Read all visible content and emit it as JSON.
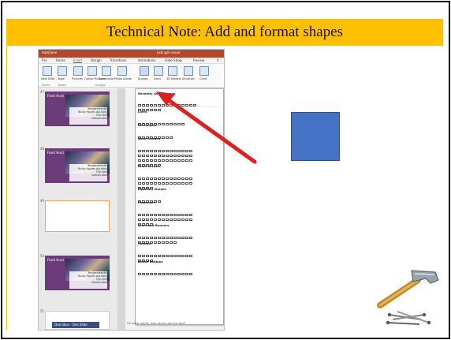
{
  "slide": {
    "title": "Technical Note: Add and format shapes"
  },
  "screenshot": {
    "app_title_left": "AutoSave",
    "app_title_mid": "Lets get visual",
    "tabs": [
      "File",
      "Home",
      "Insert",
      "Design",
      "Transitions",
      "Animations",
      "Slide Show",
      "Review",
      "V"
    ],
    "active_tab": "Insert",
    "ribbon_buttons": [
      "New Slide",
      "Table",
      "Pictures",
      "Online Pictures",
      "Screenshot",
      "Photo Album",
      "Shapes",
      "Icons",
      "3D Models",
      "SmartArt",
      "Chart"
    ],
    "ribbon_groups": [
      "Slides",
      "Tables",
      "Images"
    ],
    "thumb_numbers": [
      "47",
      "48",
      "49",
      "50",
      "51"
    ],
    "thumb_title": "Front Hunt",
    "thumb_lines": [
      "Temperamental",
      "Bushy figures too early",
      "Thin skin",
      "Complicated"
    ],
    "thumb_last_label": "One Idea – One Slide",
    "dropdown_sections": [
      "Recently Used Shapes",
      "Lines",
      "Rectangles",
      "Basic Shapes",
      "Block Arrows",
      "Equation Shapes",
      "Flowchart",
      "Stars and Banners",
      "Callouts",
      "Action Buttons"
    ],
    "bottom_note": "On other words, how do we use this tool?"
  },
  "colors": {
    "title_bar": "#ffc000",
    "arrow": "#e02020",
    "shape": "#4472c4"
  },
  "icons": {
    "hammer": "hammer-icon",
    "nails": "nails-icon"
  }
}
